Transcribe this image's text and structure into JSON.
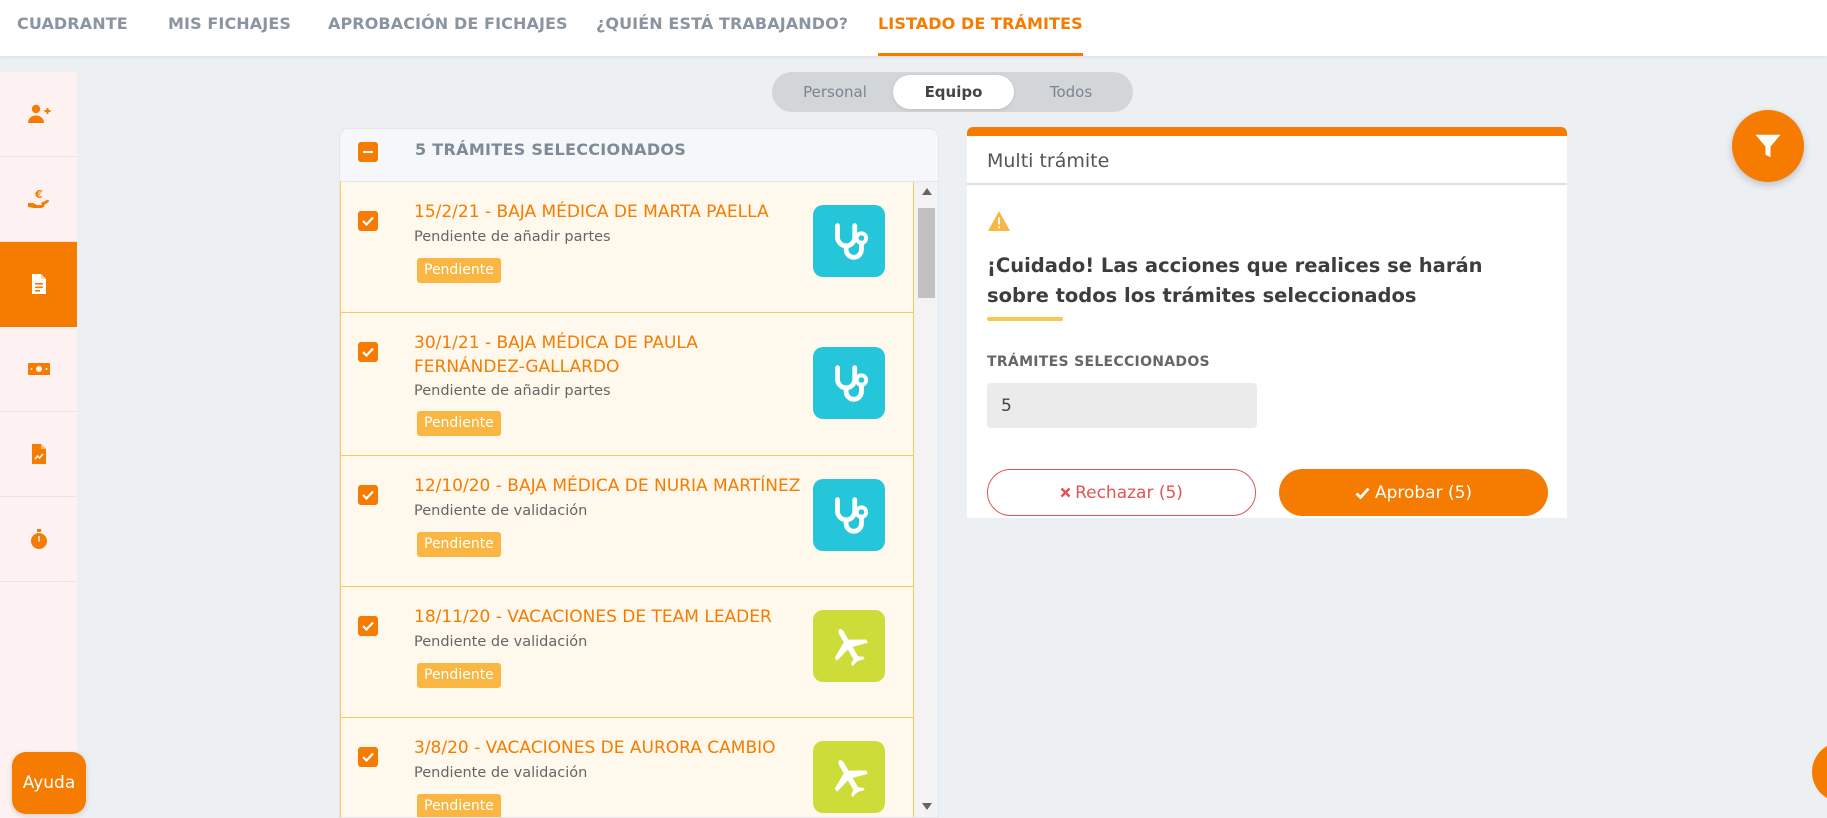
{
  "topnav": {
    "tabs": [
      {
        "label": "CUADRANTE"
      },
      {
        "label": "MIS FICHAJES"
      },
      {
        "label": "APROBACIÓN DE FICHAJES"
      },
      {
        "label": "¿QUIÉN ESTÁ TRABAJANDO?"
      },
      {
        "label": "LISTADO DE TRÁMITES",
        "active": true
      }
    ]
  },
  "sidebar": {
    "items": [
      {
        "icon": "add-user-icon"
      },
      {
        "icon": "euro-hand-icon"
      },
      {
        "icon": "document-icon",
        "active": true
      },
      {
        "icon": "money-bill-icon"
      },
      {
        "icon": "file-chart-icon"
      },
      {
        "icon": "stopwatch-icon"
      }
    ]
  },
  "help": {
    "label": "Ayuda"
  },
  "segment": {
    "options": [
      "Personal",
      "Equipo",
      "Todos"
    ],
    "selected": "Equipo"
  },
  "list": {
    "header": "5 TRÁMITES SELECCIONADOS",
    "items": [
      {
        "title": "15/2/21 - BAJA MÉDICA DE MARTA PAELLA",
        "subtitle": "Pendiente de añadir partes",
        "status": "Pendiente",
        "icon": "stethoscope-icon",
        "checked": true
      },
      {
        "title": "30/1/21 - BAJA MÉDICA DE PAULA FERNÁNDEZ-GALLARDO",
        "subtitle": "Pendiente de añadir partes",
        "status": "Pendiente",
        "icon": "stethoscope-icon",
        "checked": true
      },
      {
        "title": "12/10/20 - BAJA MÉDICA DE NURIA MARTÍNEZ",
        "subtitle": "Pendiente de validación",
        "status": "Pendiente",
        "icon": "stethoscope-icon",
        "checked": true
      },
      {
        "title": "18/11/20 - VACACIONES DE TEAM LEADER",
        "subtitle": "Pendiente de validación",
        "status": "Pendiente",
        "icon": "airplane-icon",
        "checked": true
      },
      {
        "title": "3/8/20 - VACACIONES DE AURORA CAMBIO",
        "subtitle": "Pendiente de validación",
        "status": "Pendiente",
        "icon": "airplane-icon",
        "checked": true
      }
    ]
  },
  "detail": {
    "title": "Multi trámite",
    "warning": "¡Cuidado! Las acciones que realices se harán sobre todos los trámites seleccionados",
    "selected_label": "TRÁMITES SELECCIONADOS",
    "selected_value": "5",
    "reject_label": "Rechazar (5)",
    "approve_label": "Aprobar (5)"
  },
  "colors": {
    "accent": "#f57c00",
    "medical": "#26c6da",
    "vacation": "#cddc39",
    "badge": "#f9b642",
    "reject": "#e05555"
  }
}
